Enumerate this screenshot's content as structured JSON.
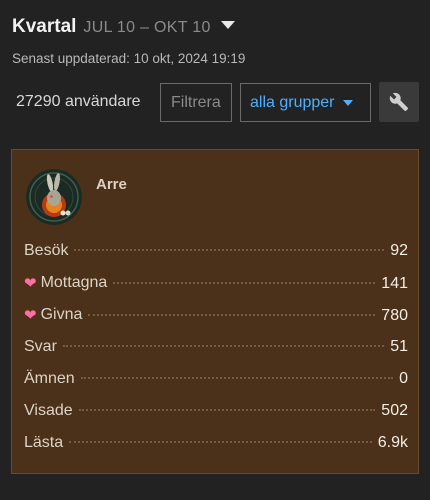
{
  "header": {
    "title": "Kvartal",
    "date_range": "JUL 10 – OKT 10",
    "updated": "Senast uppdaterad: 10 okt, 2024 19:19"
  },
  "controls": {
    "user_count": "27290 användare",
    "filter_placeholder": "Filtrera",
    "group_label": "alla grupper"
  },
  "card": {
    "username": "Arre",
    "stats": [
      {
        "label": "Besök",
        "value": "92",
        "icon": ""
      },
      {
        "label": "Mottagna",
        "value": "141",
        "icon": "heart-icon"
      },
      {
        "label": "Givna",
        "value": "780",
        "icon": "heart-icon"
      },
      {
        "label": "Svar",
        "value": "51",
        "icon": ""
      },
      {
        "label": "Ämnen",
        "value": "0",
        "icon": ""
      },
      {
        "label": "Visade",
        "value": "502",
        "icon": ""
      },
      {
        "label": "Lästa",
        "value": "6.9k",
        "icon": ""
      }
    ]
  },
  "colors": {
    "accent": "#4fb0ff",
    "card_background": "#4b3119",
    "heart": "#ff6fa5"
  }
}
